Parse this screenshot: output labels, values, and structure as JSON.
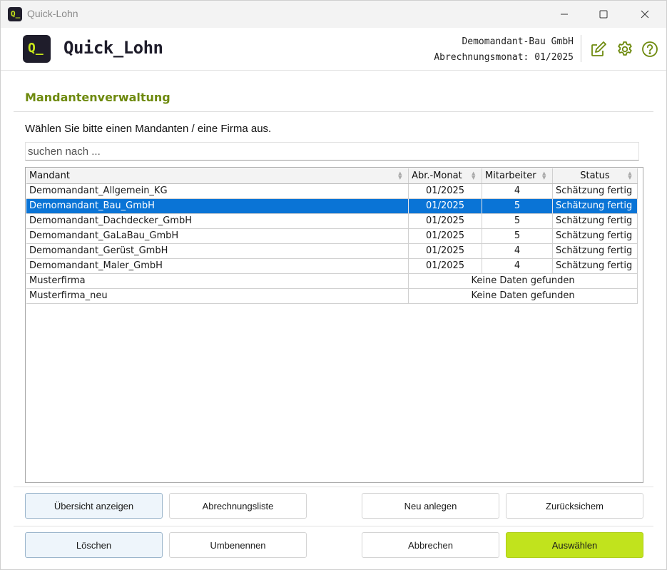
{
  "window": {
    "title": "Quick-Lohn"
  },
  "header": {
    "brand": "Quick_Lohn",
    "logo_text": "Q_",
    "company": "Demomandant-Bau GmbH",
    "month_line": "Abrechnungsmonat: 01/2025"
  },
  "page": {
    "title": "Mandantenverwaltung",
    "instruction": "Wählen Sie bitte einen Mandanten / eine Firma aus.",
    "search_placeholder": "suchen nach ..."
  },
  "table": {
    "headers": [
      "Mandant",
      "Abr.-Monat",
      "Mitarbeiter",
      "Status"
    ],
    "no_data_text": "Keine Daten gefunden",
    "rows": [
      {
        "mandant": "Demomandant_Allgemein_KG",
        "monat": "01/2025",
        "mitarbeiter": "4",
        "status": "Schätzung fertig"
      },
      {
        "mandant": "Demomandant_Bau_GmbH",
        "monat": "01/2025",
        "mitarbeiter": "5",
        "status": "Schätzung fertig",
        "selected": true
      },
      {
        "mandant": "Demomandant_Dachdecker_GmbH",
        "monat": "01/2025",
        "mitarbeiter": "5",
        "status": "Schätzung fertig"
      },
      {
        "mandant": "Demomandant_GaLaBau_GmbH",
        "monat": "01/2025",
        "mitarbeiter": "5",
        "status": "Schätzung fertig"
      },
      {
        "mandant": "Demomandant_Gerüst_GmbH",
        "monat": "01/2025",
        "mitarbeiter": "4",
        "status": "Schätzung fertig"
      },
      {
        "mandant": "Demomandant_Maler_GmbH",
        "monat": "01/2025",
        "mitarbeiter": "4",
        "status": "Schätzung fertig"
      },
      {
        "mandant": "Musterfirma",
        "no_data": "Keine Daten gefunden"
      },
      {
        "mandant": "Musterfirma_neu",
        "no_data": "Keine Daten gefunden"
      }
    ]
  },
  "buttons": {
    "overview": "Übersicht anzeigen",
    "billing_list": "Abrechnungsliste",
    "new": "Neu anlegen",
    "restore": "Zurücksichem",
    "delete": "Löschen",
    "rename": "Umbenennen",
    "cancel": "Abbrechen",
    "select": "Auswählen"
  },
  "colors": {
    "accent_green": "#c1e31d",
    "title_green": "#6e8a0e",
    "selection_blue": "#0a74d6",
    "logo_bg": "#1f1d2b"
  }
}
